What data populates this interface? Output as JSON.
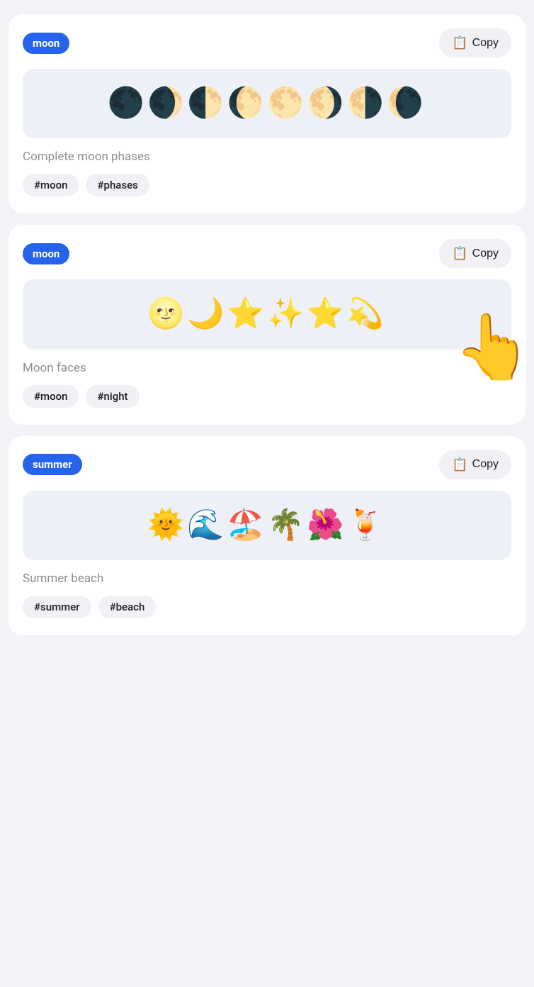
{
  "cards": [
    {
      "id": "card-1",
      "tag": "moon",
      "copy_label": "Copy",
      "emoji_content": "🌑🌒🌓🌔🌕🌖🌗🌘",
      "description": "Complete moon phases",
      "hashtags": [
        "#moon",
        "#phases"
      ],
      "has_cursor": false
    },
    {
      "id": "card-2",
      "tag": "moon",
      "copy_label": "Copy",
      "emoji_content": "🌝🌙⭐✨⭐💫",
      "description": "Moon faces",
      "hashtags": [
        "#moon",
        "#night"
      ],
      "has_cursor": true
    },
    {
      "id": "card-3",
      "tag": "summer",
      "copy_label": "Copy",
      "emoji_content": "🌞🌊🏖️🌴🌺🍹",
      "description": "Summer beach",
      "hashtags": [
        "#summer",
        "#beach"
      ],
      "has_cursor": false
    }
  ]
}
